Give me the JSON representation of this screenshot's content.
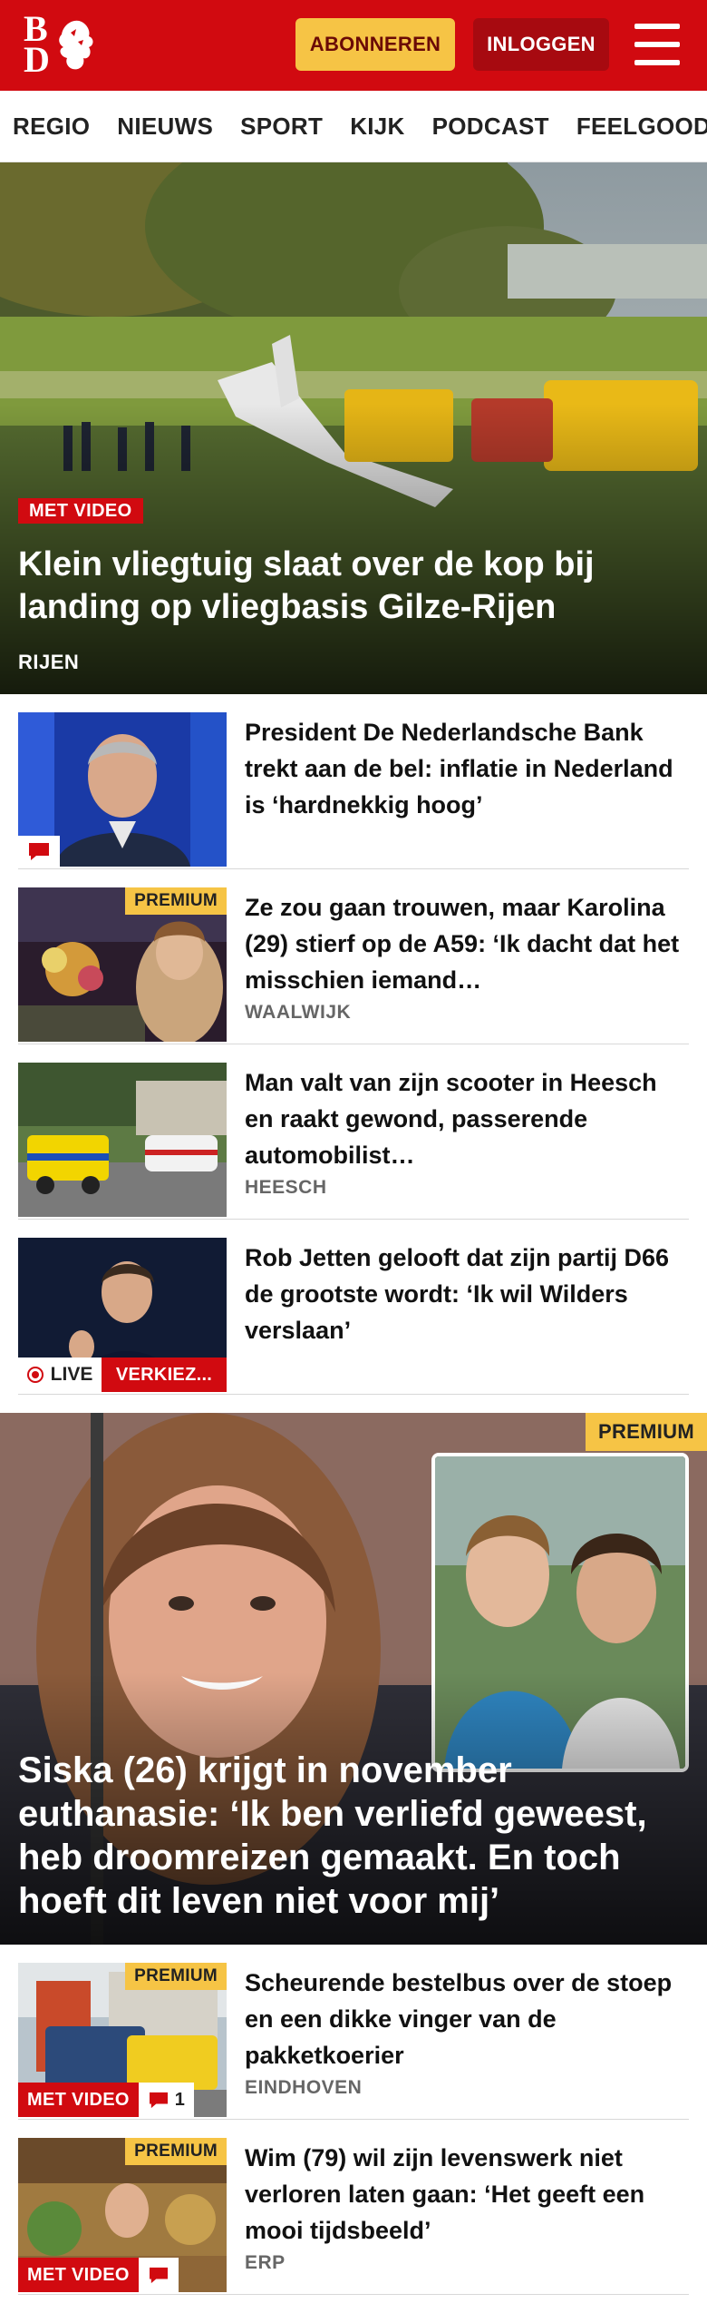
{
  "header": {
    "logo_top": "B",
    "logo_bottom": "D",
    "subscribe_label": "ABONNEREN",
    "login_label": "INLOGGEN"
  },
  "nav": {
    "items": [
      "REGIO",
      "NIEUWS",
      "SPORT",
      "KIJK",
      "PODCAST",
      "FEELGOOD"
    ]
  },
  "hero": {
    "badge": "MET VIDEO",
    "title": "Klein vliegtuig slaat over de kop bij landing op vliegbasis Gilze-Rijen",
    "location": "RIJEN"
  },
  "articles": [
    {
      "title": "President De Nederlandsche Bank trekt aan de bel: inflatie in Nederland is ‘hardnekkig hoog’",
      "location": "",
      "comment_icon": "comment-icon"
    },
    {
      "premium": "PREMIUM",
      "title": "Ze zou gaan trouwen, maar Karolina (29) stierf op de A59: ‘Ik dacht dat het misschien iemand…",
      "location": "WAALWIJK"
    },
    {
      "title": "Man valt van zijn scooter in Heesch en raakt gewond, passerende automobilist…",
      "location": "HEESCH"
    },
    {
      "title": "Rob Jetten gelooft dat zijn partij D66 de grootste wordt: ‘Ik wil Wilders verslaan’",
      "live_label": "LIVE",
      "live_tag": "VERKIEZ..."
    }
  ],
  "feature": {
    "premium": "PREMIUM",
    "title": "Siska (26) krijgt in november euthanasie: ‘Ik ben verliefd geweest, heb droomreizen gemaakt. En toch hoeft dit leven niet voor mij’"
  },
  "articles2": [
    {
      "premium": "PREMIUM",
      "video": "MET VIDEO",
      "comments": "1",
      "title": "Scheurende bestelbus over de stoep en een dikke vinger van de pakketkoerier",
      "location": "EINDHOVEN"
    },
    {
      "premium": "PREMIUM",
      "video": "MET VIDEO",
      "title": "Wim (79) wil zijn levenswerk niet verloren laten gaan: ‘Het geeft een mooi tijdsbeeld’",
      "location": "ERP"
    }
  ],
  "colors": {
    "brand_red": "#d10a10",
    "subscribe_yellow": "#f6c445",
    "login_dark_red": "#a70a10"
  }
}
